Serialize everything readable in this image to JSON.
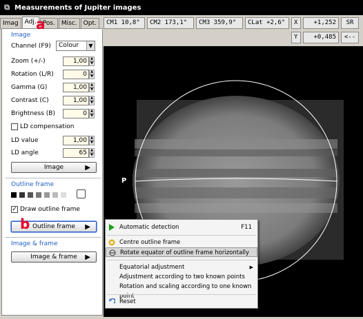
{
  "window": {
    "title": "Measurements of Jupiter images"
  },
  "tabs": [
    "Imag",
    "Adj.",
    "Pos.",
    "Misc.",
    "Opt."
  ],
  "image_section": {
    "title": "Image",
    "channel_label": "Channel (F9)",
    "channel_value": "Colour",
    "zoom_label": "Zoom (+/-)",
    "zoom_value": "1,00",
    "rotation_label": "Rotation (L/R)",
    "rotation_value": "0",
    "gamma_label": "Gamma (G)",
    "gamma_value": "1,00",
    "contrast_label": "Contrast (C)",
    "contrast_value": "1,00",
    "brightness_label": "Brightness (B)",
    "brightness_value": "0",
    "ld_comp_label": "LD compensation",
    "ld_value_label": "LD value",
    "ld_value": "1,00",
    "ld_angle_label": "LD angle",
    "ld_angle": "65",
    "image_button": "Image"
  },
  "outline_section": {
    "title": "Outline frame",
    "draw_label": "Draw outline frame",
    "button": "Outline frame",
    "swatches": [
      "#000000",
      "#333333",
      "#555555",
      "#777777",
      "#999999",
      "#bbbbbb",
      "#dddddd",
      "#ffffff"
    ]
  },
  "image_frame_section": {
    "title": "Image & frame",
    "button": "Image & frame"
  },
  "toolbar": {
    "cm1": "CM1  10,8°",
    "cm2": "CM2 173,1°",
    "cm3": "CM3 359,9°",
    "clat": "CLat  +2,6°",
    "x_label": "X",
    "x_value": "+1,252",
    "y_label": "Y",
    "y_value": "+0,485",
    "sr": "SR",
    "back": "<--"
  },
  "viewer": {
    "p_label": "P"
  },
  "annotations": {
    "a": "a",
    "b": "b",
    "c": "c"
  },
  "menu": {
    "auto": "Automatic detection",
    "auto_key": "F11",
    "centre": "Centre outline frame",
    "rotate": "Rotate equator of outline frame horizontally",
    "equatorial": "Equatorial adjustment",
    "two_points": "Adjustment according to two known points",
    "rot_scale": "Rotation and scaling according to one known point",
    "reset": "Reset"
  }
}
